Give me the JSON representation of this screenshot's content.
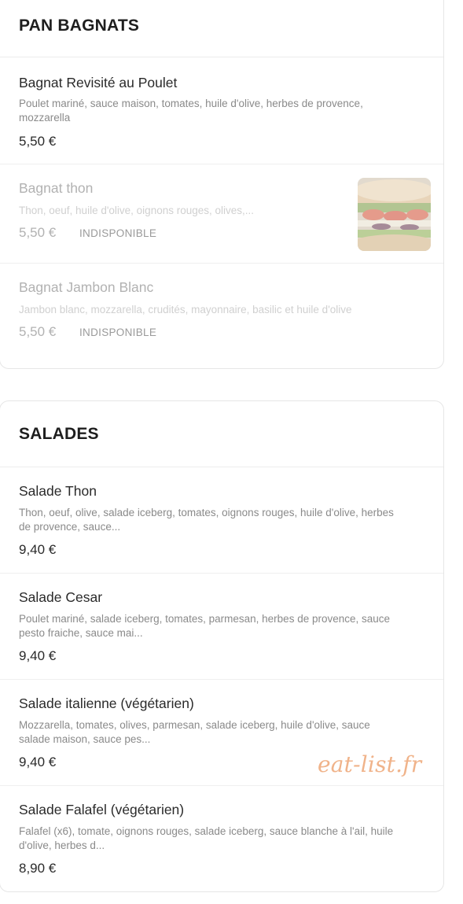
{
  "sections": [
    {
      "title": "PAN BAGNATS",
      "items": [
        {
          "name": "Bagnat Revisité au Poulet",
          "desc": "Poulet mariné, sauce maison, tomates, huile d'olive, herbes de provence, mozzarella",
          "price": "5,50 €"
        },
        {
          "name": "Bagnat thon",
          "desc": "Thon, oeuf, huile d'olive, oignons rouges, olives,...",
          "price": "5,50 €",
          "badge": "INDISPONIBLE",
          "image_icon": "sandwich-photo"
        },
        {
          "name": "Bagnat Jambon Blanc",
          "desc": "Jambon blanc, mozzarella, crudités, mayonnaire, basilic et huile d'olive",
          "price": "5,50 €",
          "badge": "INDISPONIBLE"
        }
      ]
    },
    {
      "title": "SALADES",
      "items": [
        {
          "name": "Salade Thon",
          "desc": "Thon, oeuf, olive, salade iceberg, tomates, oignons rouges, huile d'olive, herbes de provence, sauce...",
          "price": "9,40 €"
        },
        {
          "name": "Salade Cesar",
          "desc": "Poulet mariné, salade iceberg, tomates, parmesan, herbes de provence, sauce pesto fraiche, sauce mai...",
          "price": "9,40 €"
        },
        {
          "name": "Salade italienne (végétarien)",
          "desc": "Mozzarella, tomates, olives, parmesan, salade iceberg, huile d'olive, sauce salade maison, sauce pes...",
          "price": "9,40 €"
        },
        {
          "name": "Salade Falafel (végétarien)",
          "desc": "Falafel (x6), tomate, oignons rouges, salade iceberg, sauce blanche à l'ail, huile d'olive, herbes d...",
          "price": "8,90 €"
        }
      ]
    }
  ],
  "watermark": "eat-list.fr",
  "colors": {
    "watermark": "#f0b38a",
    "muted": "#8a8a8a",
    "border": "#e6e6e6"
  }
}
